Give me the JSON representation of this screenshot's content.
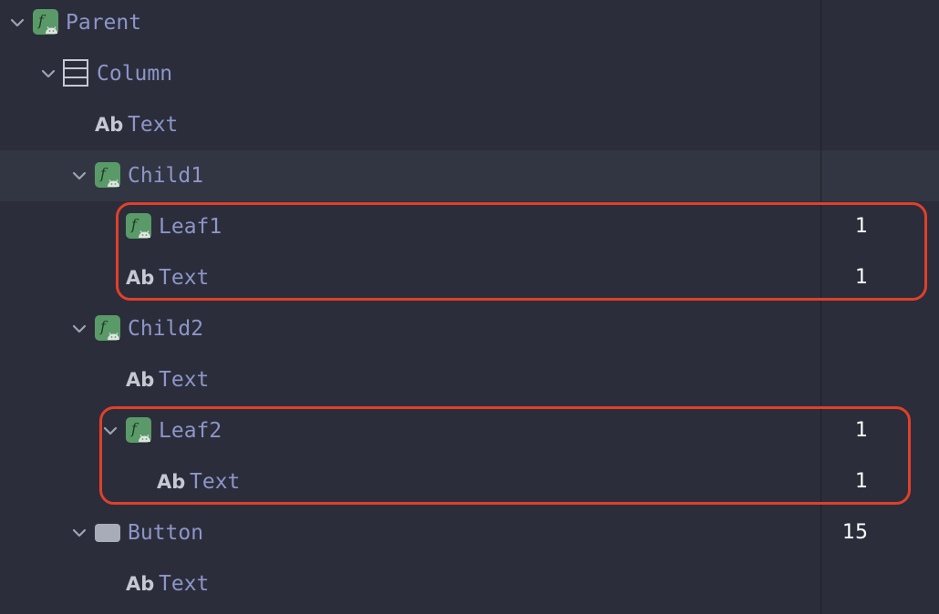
{
  "highlight_color": "#e0402a",
  "icon_names": {
    "composable": "composable-icon",
    "column": "column-layout-icon",
    "text": "text-ab-icon",
    "button": "button-shape-icon",
    "expand": "chevron-down-icon"
  },
  "tree": [
    {
      "label": "Parent",
      "icon": "composable",
      "expanded": true,
      "count": ""
    },
    {
      "label": "Column",
      "icon": "column",
      "expanded": true,
      "count": ""
    },
    {
      "label": "Text",
      "icon": "text",
      "icon_text": "Ab",
      "expanded": false,
      "count": ""
    },
    {
      "label": "Child1",
      "icon": "composable",
      "expanded": true,
      "count": "",
      "selected": true
    },
    {
      "label": "Leaf1",
      "icon": "composable",
      "expanded": false,
      "count": "1"
    },
    {
      "label": "Text",
      "icon": "text",
      "icon_text": "Ab",
      "expanded": false,
      "count": "1"
    },
    {
      "label": "Child2",
      "icon": "composable",
      "expanded": true,
      "count": ""
    },
    {
      "label": "Text",
      "icon": "text",
      "icon_text": "Ab",
      "expanded": false,
      "count": ""
    },
    {
      "label": "Leaf2",
      "icon": "composable",
      "expanded": true,
      "count": "1"
    },
    {
      "label": "Text",
      "icon": "text",
      "icon_text": "Ab",
      "expanded": false,
      "count": "1"
    },
    {
      "label": "Button",
      "icon": "button",
      "expanded": true,
      "count": "15"
    },
    {
      "label": "Text",
      "icon": "text",
      "icon_text": "Ab",
      "expanded": false,
      "count": ""
    }
  ]
}
